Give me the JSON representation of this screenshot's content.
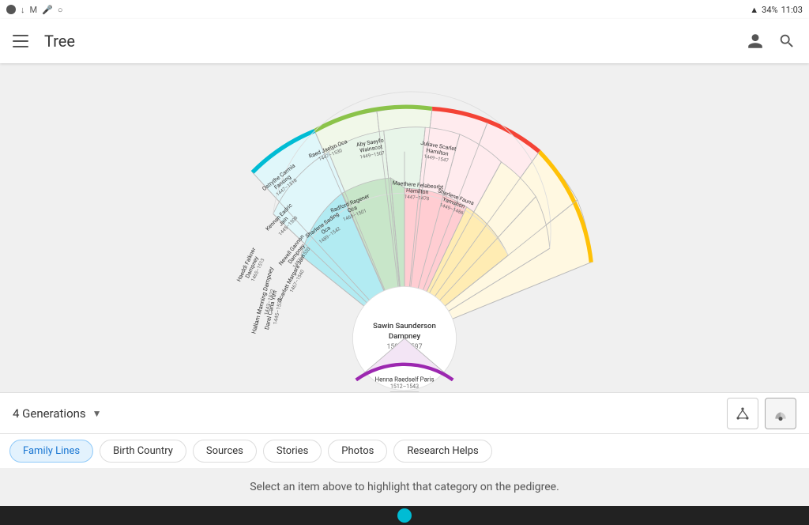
{
  "statusBar": {
    "time": "11:03",
    "battery": "34%",
    "icons": [
      "notification",
      "download",
      "gmail",
      "mic",
      "circle"
    ]
  },
  "appBar": {
    "title": "Tree",
    "menuIcon": "hamburger-icon",
    "actions": [
      "person-icon",
      "search-icon"
    ]
  },
  "generationsSelector": {
    "label": "4 Generations",
    "dropdownIcon": "chevron-down-icon"
  },
  "filterTabs": [
    {
      "id": "family-lines",
      "label": "Family Lines",
      "active": true
    },
    {
      "id": "birth-country",
      "label": "Birth Country",
      "active": false
    },
    {
      "id": "sources",
      "label": "Sources",
      "active": false
    },
    {
      "id": "stories",
      "label": "Stories",
      "active": false
    },
    {
      "id": "photos",
      "label": "Photos",
      "active": false
    },
    {
      "id": "research-helps",
      "label": "Research Helps",
      "active": false
    }
  ],
  "statusMessage": "Select an item above to highlight that category on the pedigree.",
  "centerPerson": {
    "name": "Sawin Saunderson Dampney",
    "years": "1509–1597"
  },
  "fanPersons": [
    {
      "name": "Henna Raedself Paris",
      "years": "1512–1543",
      "generation": 2,
      "position": "bottom-left",
      "color": "#9c27b0"
    },
    {
      "name": "Hallam Manning Dampney",
      "years": "1443–1522",
      "generation": 2,
      "position": "far-left",
      "color": "#00bcd4"
    },
    {
      "name": "Haeddi Falkner Dampney",
      "years": "1465–1513",
      "generation": 3,
      "position": "mid-left",
      "color": "#00bcd4"
    },
    {
      "name": "Newell Gannon Dampney",
      "years": "1487–1520",
      "generation": 3,
      "position": "inner-left",
      "color": "#4caf50"
    },
    {
      "name": "Sharlene Sading Oca",
      "years": "1489–1542",
      "generation": 3,
      "position": "inner-right",
      "color": "#4caf50"
    },
    {
      "name": "Darel Carla Yim",
      "years": "1445–1533",
      "generation": 2,
      "position": "left",
      "color": "#4caf50"
    },
    {
      "name": "Scarlett Margara Jain",
      "years": "1467–1540",
      "generation": 3,
      "position": "center-left",
      "color": "#4caf50"
    },
    {
      "name": "Kennan Eadric Jain",
      "years": "1445–1508",
      "generation": 3,
      "position": "upper-center-left",
      "color": "#8bc34a"
    },
    {
      "name": "Ostrythe Carmia Fansing",
      "years": "1447–1518",
      "generation": 4,
      "position": "outer-center-left",
      "color": "#8bc34a"
    },
    {
      "name": "Raed Jaelyn Oca",
      "years": "1447–1530",
      "generation": 4,
      "position": "outer-center",
      "color": "#f44336"
    },
    {
      "name": "Radford Ragener Oca",
      "years": "1465–1501",
      "generation": 3,
      "position": "center-right",
      "color": "#f44336"
    },
    {
      "name": "Aby Saeyfo Wainscot",
      "years": "1449–1507",
      "generation": 4,
      "position": "outer-center-right",
      "color": "#f44336"
    },
    {
      "name": "Maethere Felabeorbt Hamilton",
      "years": "1447–1478",
      "generation": 3,
      "position": "right",
      "color": "#ffc107"
    },
    {
      "name": "Juliave Scarlet Hamilton",
      "years": "1449–1547",
      "generation": 4,
      "position": "outer-right",
      "color": "#ffc107"
    },
    {
      "name": "Sharlene Fauna Yamshon",
      "years": "1449–1486",
      "generation": 3,
      "position": "far-right",
      "color": "#ffc107"
    }
  ]
}
